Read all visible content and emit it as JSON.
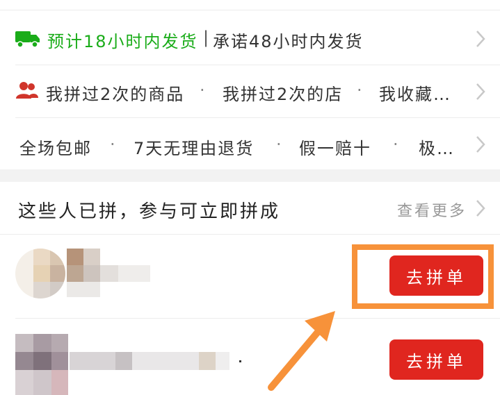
{
  "shipping": {
    "estimate_label": "预计18小时内发货",
    "separator": "|",
    "promise_label": "承诺48小时内发货"
  },
  "history": {
    "items": [
      "我拼过2次的商品",
      "我拼过2次的店",
      "我收藏…"
    ],
    "dot": "·"
  },
  "guarantees": {
    "items": [
      "全场包邮",
      "7天无理由退货",
      "假一赔十",
      "极…"
    ],
    "dot": "·"
  },
  "group_section": {
    "title": "这些人已拼，参与可立即拼成",
    "more_label": "查看更多"
  },
  "groups": [
    {
      "button_label": "去拼单"
    },
    {
      "button_label": "去拼单"
    }
  ],
  "colors": {
    "accent_green": "#1aac19",
    "accent_red": "#e0261f",
    "highlight_orange": "#f7923a"
  },
  "icons": {
    "truck": "truck-icon",
    "people": "people-icon",
    "chevron": "chevron-right-icon",
    "arrow": "arrow-annotation"
  }
}
